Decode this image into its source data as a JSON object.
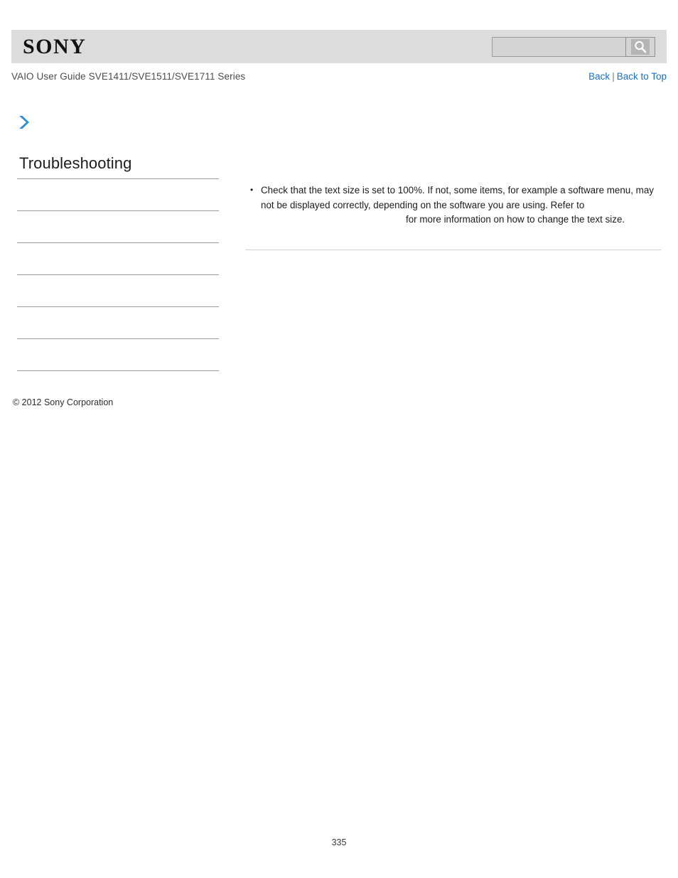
{
  "header": {
    "logo_text": "SONY",
    "logo_icon": "sony-wordmark",
    "search": {
      "value": "",
      "placeholder": "",
      "button_icon": "search-icon",
      "button_label": "Search"
    }
  },
  "guide": {
    "title": "VAIO User Guide SVE1411/SVE1511/SVE1711 Series",
    "nav": {
      "back_label": "Back",
      "separator": "|",
      "back_to_top_label": "Back to Top"
    }
  },
  "breadcrumb": {
    "icon": "chevron-right-icon",
    "label": ""
  },
  "sidebar": {
    "section_title": "Troubleshooting",
    "items": [
      {
        "label": ""
      },
      {
        "label": ""
      },
      {
        "label": ""
      },
      {
        "label": ""
      },
      {
        "label": ""
      },
      {
        "label": ""
      }
    ]
  },
  "main": {
    "bullets": [
      {
        "text_before": "Check that the text size is set to 100%. If not, some items, for example a software menu, may not be displayed correctly, depending on the software you are using. Refer to",
        "link_label": "",
        "text_after": "for more information on how to change the text size."
      }
    ]
  },
  "footer": {
    "copyright": "© 2012 Sony Corporation",
    "page_number": "335"
  },
  "colors": {
    "header_band": "#dcdcdc",
    "link_blue": "#1a6fc4",
    "chevron_blue": "#2a8fd4",
    "rule_gray": "#9b9b9b",
    "content_rule_gray": "#d2d2d2",
    "text_dark": "#1c1c1c"
  }
}
